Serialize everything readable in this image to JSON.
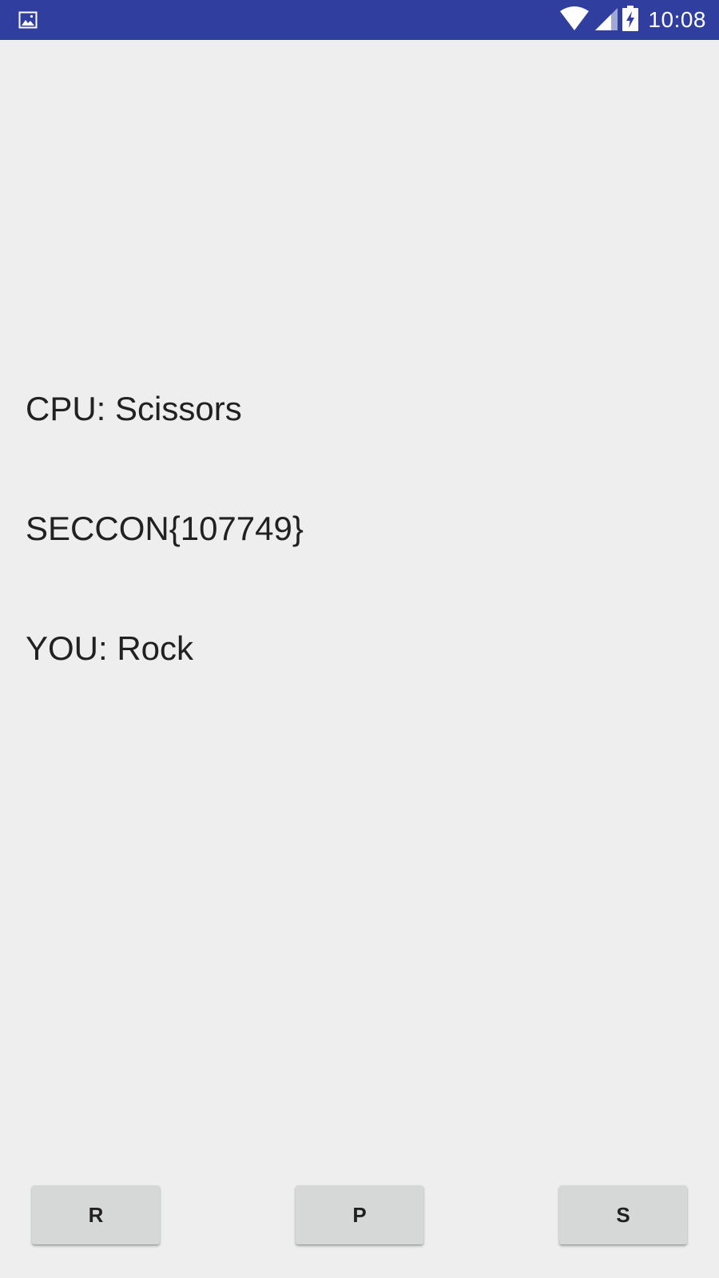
{
  "status_bar": {
    "time": "10:08",
    "left_icon": "image-icon",
    "icons": [
      "wifi-icon",
      "cell-signal-icon",
      "battery-charging-icon"
    ],
    "background": "#303f9f"
  },
  "game": {
    "cpu_text": "CPU: Scissors",
    "flag_text": "SECCON{107749}",
    "you_text": "YOU: Rock"
  },
  "buttons": {
    "rock_label": "R",
    "paper_label": "P",
    "scissors_label": "S"
  },
  "colors": {
    "background": "#eeeeee",
    "text": "#212121",
    "button": "#d6d7d7"
  }
}
